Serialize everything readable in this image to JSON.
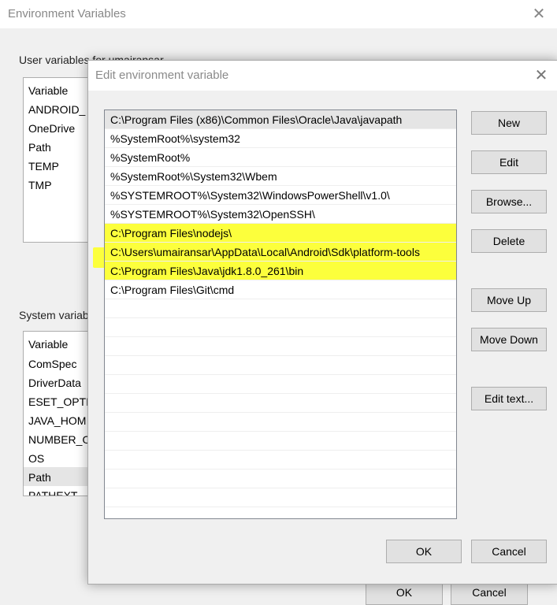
{
  "background_window": {
    "title": "Environment Variables",
    "user_group_label": "User variables for umairansar",
    "user_header": "Variable",
    "user_rows": [
      "ANDROID_",
      "OneDrive",
      "Path",
      "TEMP",
      "TMP"
    ],
    "system_group_label": "System variab",
    "system_header": "Variable",
    "system_rows": [
      "ComSpec",
      "DriverData",
      "ESET_OPTIC",
      "JAVA_HOM",
      "NUMBER_O",
      "OS",
      "Path",
      "PATHEXT"
    ],
    "ok_label": "OK",
    "cancel_label": "Cancel"
  },
  "dialog": {
    "title": "Edit environment variable",
    "paths": [
      "C:\\Program Files (x86)\\Common Files\\Oracle\\Java\\javapath",
      "%SystemRoot%\\system32",
      "%SystemRoot%",
      "%SystemRoot%\\System32\\Wbem",
      "%SYSTEMROOT%\\System32\\WindowsPowerShell\\v1.0\\",
      "%SYSTEMROOT%\\System32\\OpenSSH\\",
      "C:\\Program Files\\nodejs\\",
      "C:\\Users\\umairansar\\AppData\\Local\\Android\\Sdk\\platform-tools",
      "C:\\Program Files\\Java\\jdk1.8.0_261\\bin",
      "C:\\Program Files\\Git\\cmd"
    ],
    "buttons": {
      "new": "New",
      "edit": "Edit",
      "browse": "Browse...",
      "delete": "Delete",
      "move_up": "Move Up",
      "move_down": "Move Down",
      "edit_text": "Edit text...",
      "ok": "OK",
      "cancel": "Cancel"
    },
    "highlight_color": "#fcff3c"
  }
}
